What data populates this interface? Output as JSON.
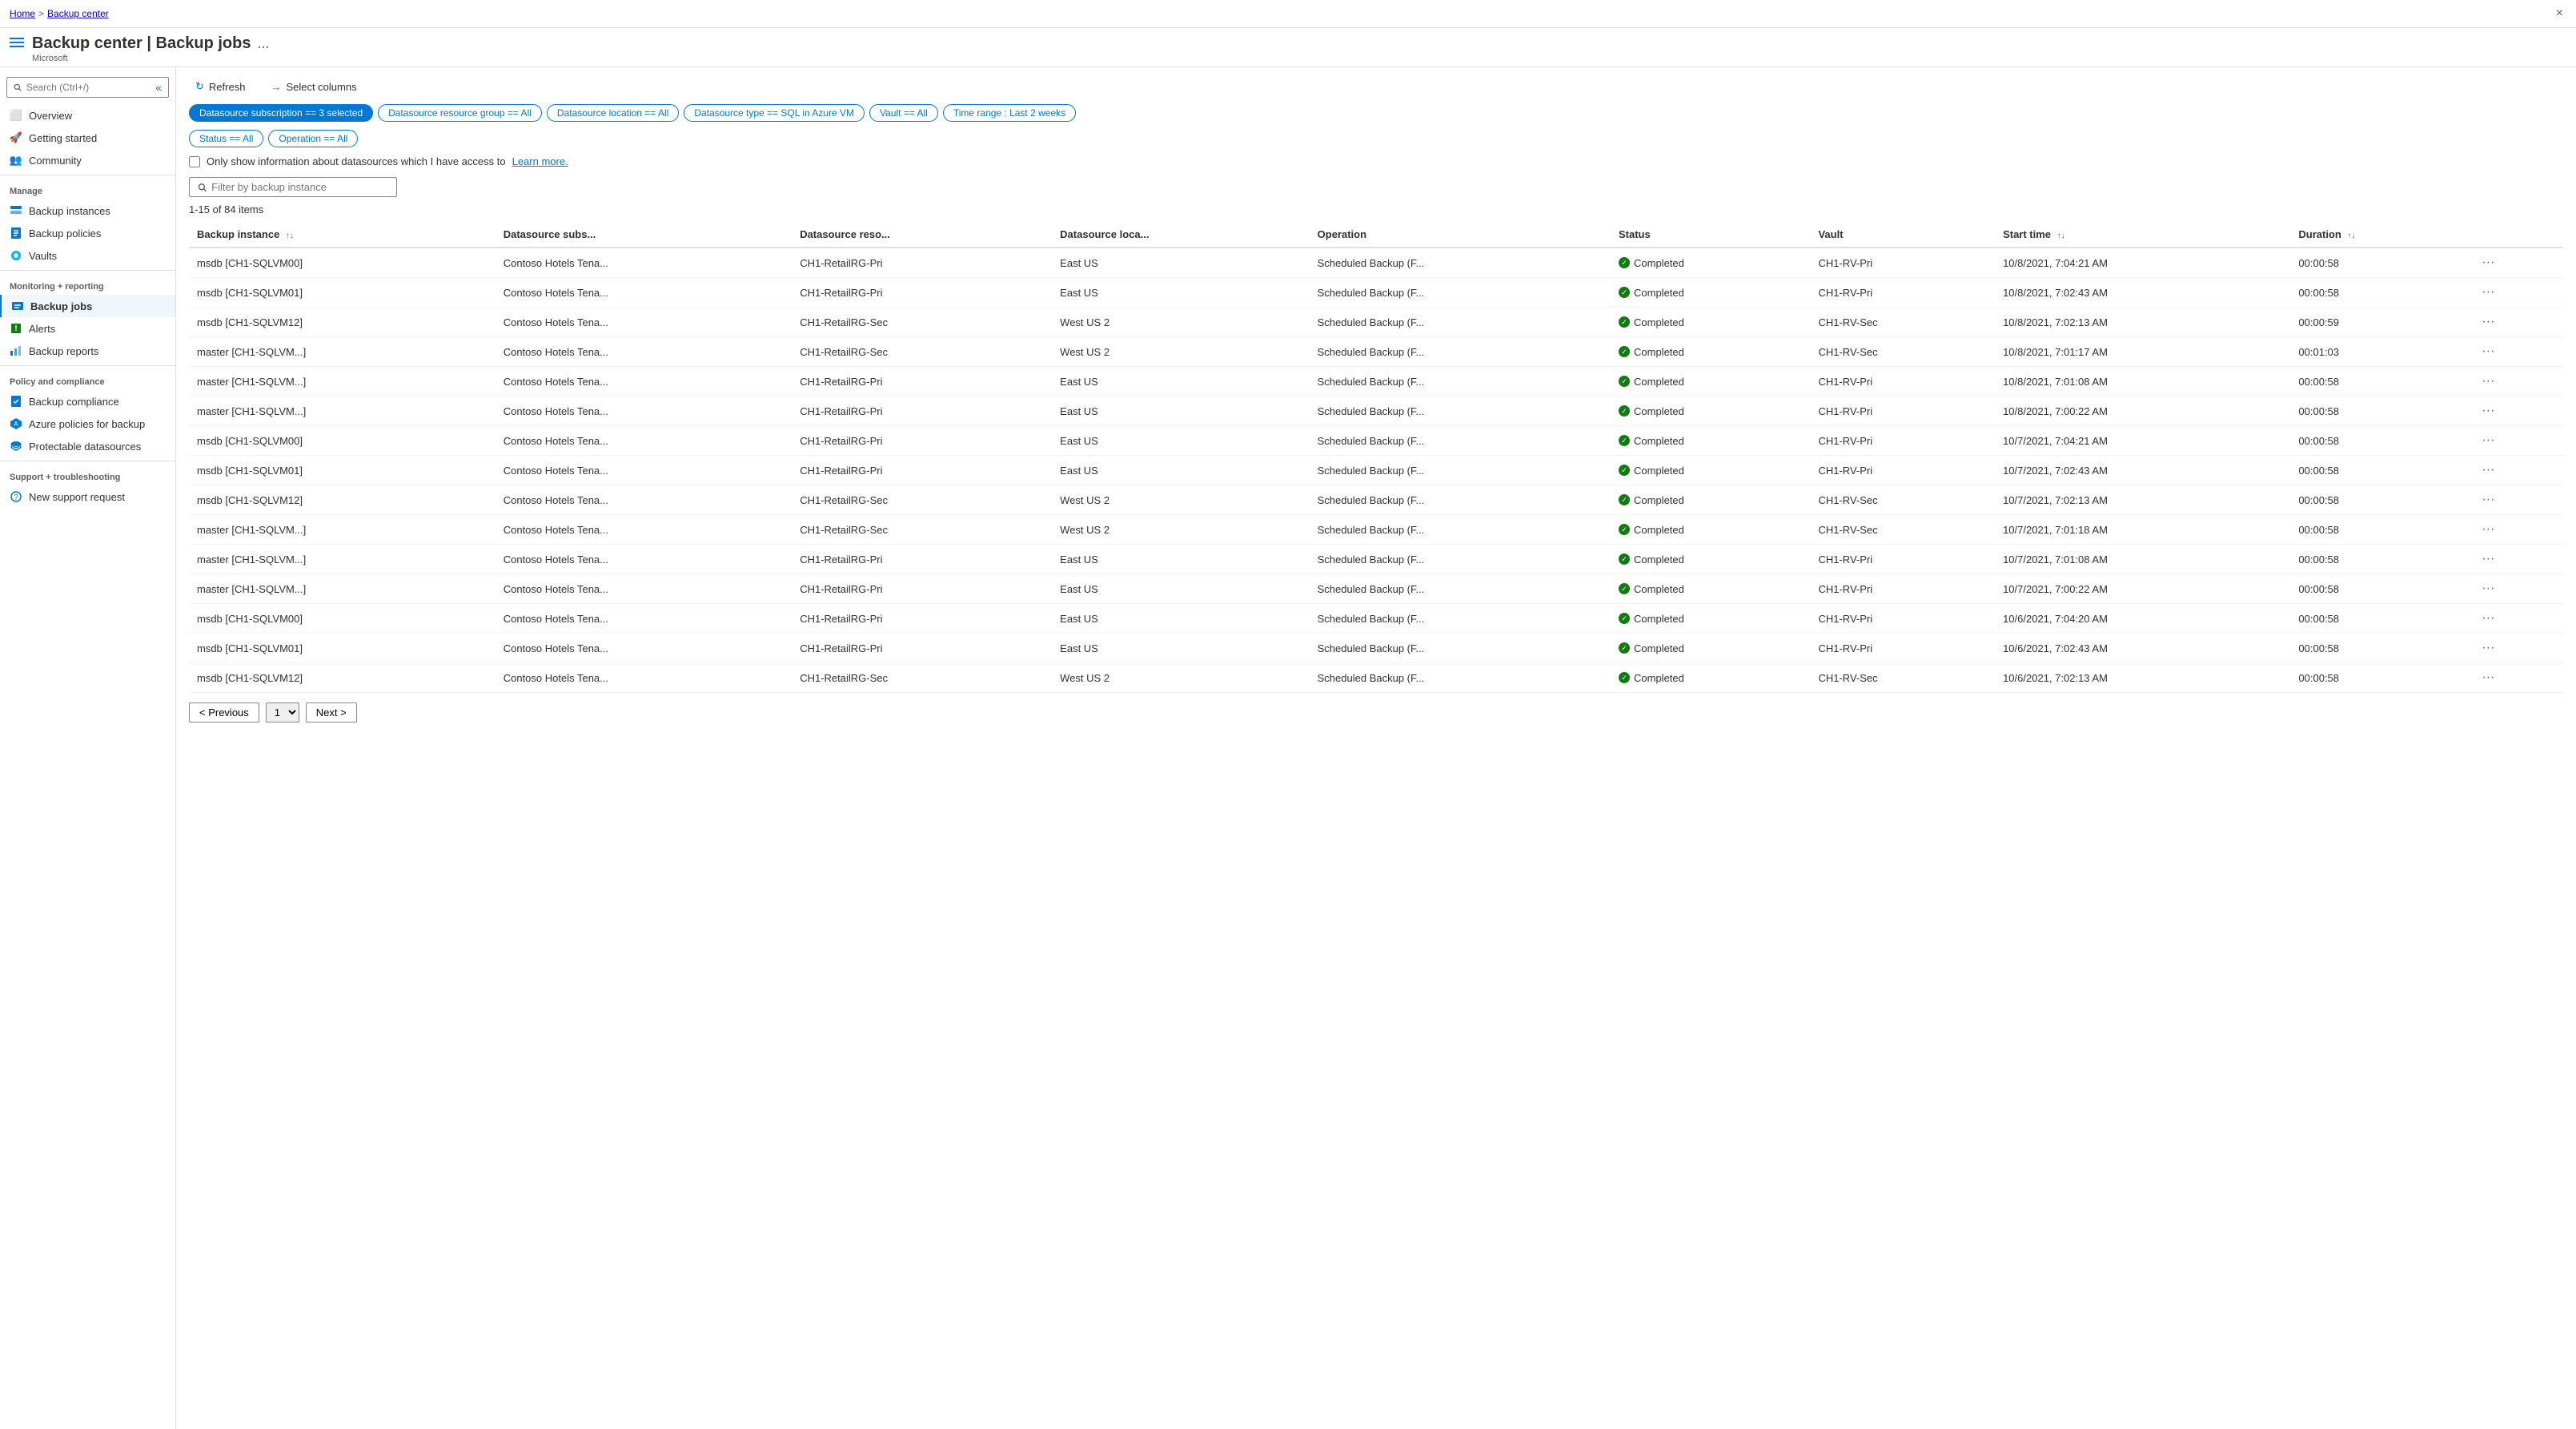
{
  "breadcrumb": {
    "home": "Home",
    "separator": ">",
    "current": "Backup center"
  },
  "header": {
    "title": "Backup center | Backup jobs",
    "subtitle": "Microsoft",
    "ellipsis": "...",
    "close_label": "×"
  },
  "sidebar": {
    "search_placeholder": "Search (Ctrl+/)",
    "collapse_label": "«",
    "items": [
      {
        "id": "overview",
        "label": "Overview",
        "icon": "overview"
      },
      {
        "id": "getting-started",
        "label": "Getting started",
        "icon": "rocket"
      },
      {
        "id": "community",
        "label": "Community",
        "icon": "community"
      }
    ],
    "manage_section": "Manage",
    "manage_items": [
      {
        "id": "backup-instances",
        "label": "Backup instances",
        "icon": "instances"
      },
      {
        "id": "backup-policies",
        "label": "Backup policies",
        "icon": "policies"
      },
      {
        "id": "vaults",
        "label": "Vaults",
        "icon": "vaults"
      }
    ],
    "monitoring_section": "Monitoring + reporting",
    "monitoring_items": [
      {
        "id": "backup-jobs",
        "label": "Backup jobs",
        "icon": "jobs",
        "active": true
      },
      {
        "id": "alerts",
        "label": "Alerts",
        "icon": "alerts"
      },
      {
        "id": "backup-reports",
        "label": "Backup reports",
        "icon": "reports"
      }
    ],
    "policy_section": "Policy and compliance",
    "policy_items": [
      {
        "id": "backup-compliance",
        "label": "Backup compliance",
        "icon": "compliance"
      },
      {
        "id": "azure-policies",
        "label": "Azure policies for backup",
        "icon": "azure-policy"
      },
      {
        "id": "protectable-datasources",
        "label": "Protectable datasources",
        "icon": "datasources"
      }
    ],
    "support_section": "Support + troubleshooting",
    "support_items": [
      {
        "id": "new-support",
        "label": "New support request",
        "icon": "support"
      }
    ]
  },
  "toolbar": {
    "refresh_label": "Refresh",
    "select_columns_label": "Select columns"
  },
  "filters": [
    {
      "id": "subscription",
      "label": "Datasource subscription == 3 selected",
      "active": true
    },
    {
      "id": "resource-group",
      "label": "Datasource resource group == All",
      "active": false
    },
    {
      "id": "location",
      "label": "Datasource location == All",
      "active": false
    },
    {
      "id": "type",
      "label": "Datasource type == SQL in Azure VM",
      "active": false
    },
    {
      "id": "vault",
      "label": "Vault == All",
      "active": false
    },
    {
      "id": "time-range",
      "label": "Time range : Last 2 weeks",
      "active": false
    },
    {
      "id": "status",
      "label": "Status == All",
      "active": false
    },
    {
      "id": "operation",
      "label": "Operation == All",
      "active": false
    }
  ],
  "checkbox": {
    "label": "Only show information about datasources which I have access to",
    "link_text": "Learn more."
  },
  "filter_search": {
    "placeholder": "Filter by backup instance"
  },
  "items_count": "1-15 of 84 items",
  "table": {
    "columns": [
      {
        "id": "backup-instance",
        "label": "Backup instance",
        "sortable": true
      },
      {
        "id": "datasource-subs",
        "label": "Datasource subs...",
        "sortable": false
      },
      {
        "id": "datasource-reso",
        "label": "Datasource reso...",
        "sortable": false
      },
      {
        "id": "datasource-loca",
        "label": "Datasource loca...",
        "sortable": false
      },
      {
        "id": "operation",
        "label": "Operation",
        "sortable": false
      },
      {
        "id": "status",
        "label": "Status",
        "sortable": false
      },
      {
        "id": "vault",
        "label": "Vault",
        "sortable": false
      },
      {
        "id": "start-time",
        "label": "Start time",
        "sortable": true
      },
      {
        "id": "duration",
        "label": "Duration",
        "sortable": true
      },
      {
        "id": "actions",
        "label": "",
        "sortable": false
      }
    ],
    "rows": [
      {
        "backup_instance": "msdb [CH1-SQLVM00]",
        "datasource_subs": "Contoso Hotels Tena...",
        "datasource_reso": "CH1-RetailRG-Pri",
        "datasource_loca": "East US",
        "operation": "Scheduled Backup (F...",
        "status": "Completed",
        "vault": "CH1-RV-Pri",
        "start_time": "10/8/2021, 7:04:21 AM",
        "duration": "00:00:58"
      },
      {
        "backup_instance": "msdb [CH1-SQLVM01]",
        "datasource_subs": "Contoso Hotels Tena...",
        "datasource_reso": "CH1-RetailRG-Pri",
        "datasource_loca": "East US",
        "operation": "Scheduled Backup (F...",
        "status": "Completed",
        "vault": "CH1-RV-Pri",
        "start_time": "10/8/2021, 7:02:43 AM",
        "duration": "00:00:58"
      },
      {
        "backup_instance": "msdb [CH1-SQLVM12]",
        "datasource_subs": "Contoso Hotels Tena...",
        "datasource_reso": "CH1-RetailRG-Sec",
        "datasource_loca": "West US 2",
        "operation": "Scheduled Backup (F...",
        "status": "Completed",
        "vault": "CH1-RV-Sec",
        "start_time": "10/8/2021, 7:02:13 AM",
        "duration": "00:00:59"
      },
      {
        "backup_instance": "master [CH1-SQLVM...]",
        "datasource_subs": "Contoso Hotels Tena...",
        "datasource_reso": "CH1-RetailRG-Sec",
        "datasource_loca": "West US 2",
        "operation": "Scheduled Backup (F...",
        "status": "Completed",
        "vault": "CH1-RV-Sec",
        "start_time": "10/8/2021, 7:01:17 AM",
        "duration": "00:01:03"
      },
      {
        "backup_instance": "master [CH1-SQLVM...]",
        "datasource_subs": "Contoso Hotels Tena...",
        "datasource_reso": "CH1-RetailRG-Pri",
        "datasource_loca": "East US",
        "operation": "Scheduled Backup (F...",
        "status": "Completed",
        "vault": "CH1-RV-Pri",
        "start_time": "10/8/2021, 7:01:08 AM",
        "duration": "00:00:58"
      },
      {
        "backup_instance": "master [CH1-SQLVM...]",
        "datasource_subs": "Contoso Hotels Tena...",
        "datasource_reso": "CH1-RetailRG-Pri",
        "datasource_loca": "East US",
        "operation": "Scheduled Backup (F...",
        "status": "Completed",
        "vault": "CH1-RV-Pri",
        "start_time": "10/8/2021, 7:00:22 AM",
        "duration": "00:00:58"
      },
      {
        "backup_instance": "msdb [CH1-SQLVM00]",
        "datasource_subs": "Contoso Hotels Tena...",
        "datasource_reso": "CH1-RetailRG-Pri",
        "datasource_loca": "East US",
        "operation": "Scheduled Backup (F...",
        "status": "Completed",
        "vault": "CH1-RV-Pri",
        "start_time": "10/7/2021, 7:04:21 AM",
        "duration": "00:00:58"
      },
      {
        "backup_instance": "msdb [CH1-SQLVM01]",
        "datasource_subs": "Contoso Hotels Tena...",
        "datasource_reso": "CH1-RetailRG-Pri",
        "datasource_loca": "East US",
        "operation": "Scheduled Backup (F...",
        "status": "Completed",
        "vault": "CH1-RV-Pri",
        "start_time": "10/7/2021, 7:02:43 AM",
        "duration": "00:00:58"
      },
      {
        "backup_instance": "msdb [CH1-SQLVM12]",
        "datasource_subs": "Contoso Hotels Tena...",
        "datasource_reso": "CH1-RetailRG-Sec",
        "datasource_loca": "West US 2",
        "operation": "Scheduled Backup (F...",
        "status": "Completed",
        "vault": "CH1-RV-Sec",
        "start_time": "10/7/2021, 7:02:13 AM",
        "duration": "00:00:58"
      },
      {
        "backup_instance": "master [CH1-SQLVM...]",
        "datasource_subs": "Contoso Hotels Tena...",
        "datasource_reso": "CH1-RetailRG-Sec",
        "datasource_loca": "West US 2",
        "operation": "Scheduled Backup (F...",
        "status": "Completed",
        "vault": "CH1-RV-Sec",
        "start_time": "10/7/2021, 7:01:18 AM",
        "duration": "00:00:58"
      },
      {
        "backup_instance": "master [CH1-SQLVM...]",
        "datasource_subs": "Contoso Hotels Tena...",
        "datasource_reso": "CH1-RetailRG-Pri",
        "datasource_loca": "East US",
        "operation": "Scheduled Backup (F...",
        "status": "Completed",
        "vault": "CH1-RV-Pri",
        "start_time": "10/7/2021, 7:01:08 AM",
        "duration": "00:00:58"
      },
      {
        "backup_instance": "master [CH1-SQLVM...]",
        "datasource_subs": "Contoso Hotels Tena...",
        "datasource_reso": "CH1-RetailRG-Pri",
        "datasource_loca": "East US",
        "operation": "Scheduled Backup (F...",
        "status": "Completed",
        "vault": "CH1-RV-Pri",
        "start_time": "10/7/2021, 7:00:22 AM",
        "duration": "00:00:58"
      },
      {
        "backup_instance": "msdb [CH1-SQLVM00]",
        "datasource_subs": "Contoso Hotels Tena...",
        "datasource_reso": "CH1-RetailRG-Pri",
        "datasource_loca": "East US",
        "operation": "Scheduled Backup (F...",
        "status": "Completed",
        "vault": "CH1-RV-Pri",
        "start_time": "10/6/2021, 7:04:20 AM",
        "duration": "00:00:58"
      },
      {
        "backup_instance": "msdb [CH1-SQLVM01]",
        "datasource_subs": "Contoso Hotels Tena...",
        "datasource_reso": "CH1-RetailRG-Pri",
        "datasource_loca": "East US",
        "operation": "Scheduled Backup (F...",
        "status": "Completed",
        "vault": "CH1-RV-Pri",
        "start_time": "10/6/2021, 7:02:43 AM",
        "duration": "00:00:58"
      },
      {
        "backup_instance": "msdb [CH1-SQLVM12]",
        "datasource_subs": "Contoso Hotels Tena...",
        "datasource_reso": "CH1-RetailRG-Sec",
        "datasource_loca": "West US 2",
        "operation": "Scheduled Backup (F...",
        "status": "Completed",
        "vault": "CH1-RV-Sec",
        "start_time": "10/6/2021, 7:02:13 AM",
        "duration": "00:00:58"
      }
    ]
  },
  "pagination": {
    "previous_label": "< Previous",
    "next_label": "Next >",
    "current_page": "1"
  }
}
